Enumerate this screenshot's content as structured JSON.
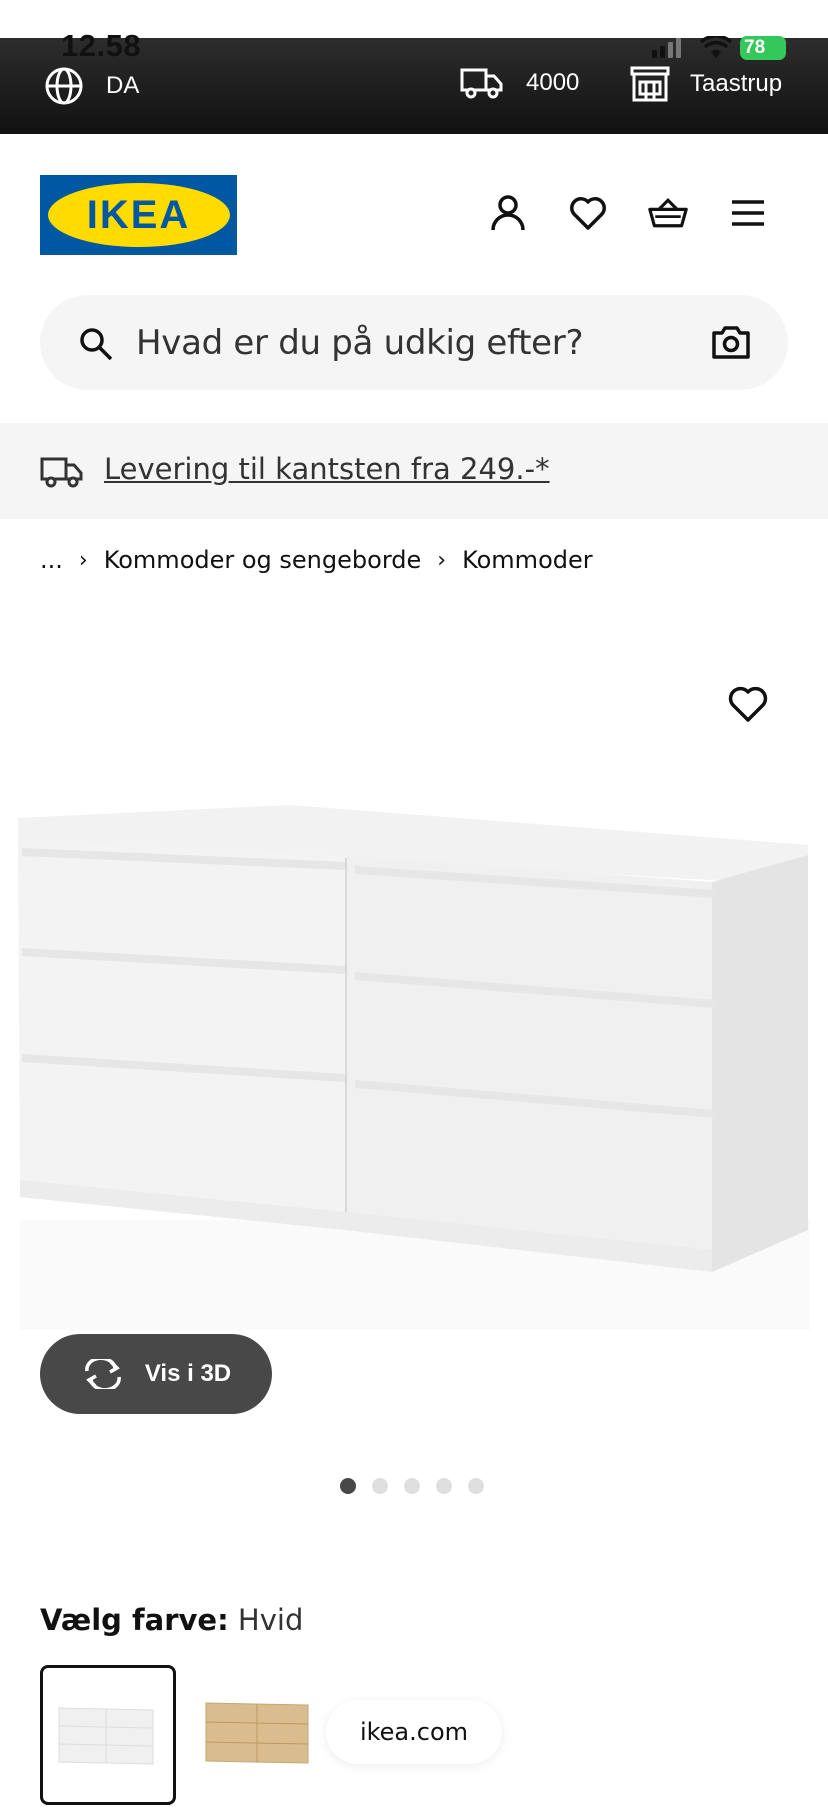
{
  "status_bar": {
    "time": "12.58",
    "battery": "78"
  },
  "top_bar": {
    "language": "DA",
    "postal_code": "4000",
    "store": "Taastrup"
  },
  "header": {
    "logo_text": "IKEA",
    "icons": [
      "user-icon",
      "heart-icon",
      "basket-icon",
      "menu-icon"
    ]
  },
  "search": {
    "placeholder": "Hvad er du på udkig efter?"
  },
  "banner": {
    "text": "Levering til kantsten fra 249.-*"
  },
  "breadcrumb": {
    "items": [
      "...",
      "Kommoder og sengeborde",
      "Kommoder"
    ]
  },
  "product": {
    "view_3d_label": "Vis i 3D",
    "image_count": 5,
    "active_image": 1
  },
  "color": {
    "label": "Vælg farve:",
    "value": "Hvid"
  },
  "browser": {
    "domain": "ikea.com"
  },
  "colors": {
    "ikea_blue": "#0058a3",
    "ikea_yellow": "#ffdb00",
    "dark_button": "#484848",
    "battery_green": "#34c759"
  }
}
